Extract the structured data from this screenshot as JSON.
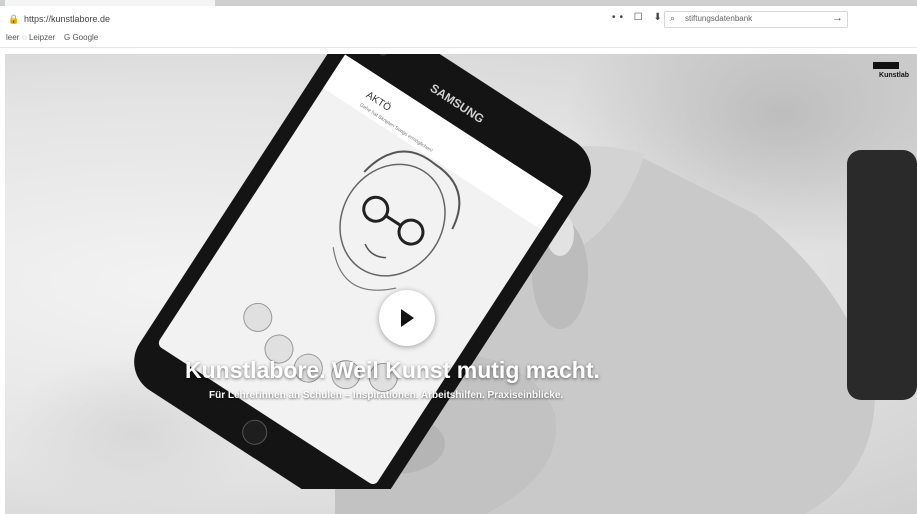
{
  "browser": {
    "url": "https://kunstlabore.de",
    "search_placeholder": "stiftungsdatenbank",
    "url_icons": "••  ☐  ⬇",
    "go_arrow": "→"
  },
  "bookmarks": [
    {
      "label": "leer"
    },
    {
      "label": "Leipzer"
    },
    {
      "label": "Google"
    }
  ],
  "hero": {
    "headline": "Kunstlabore. Weil Kunst mutig macht.",
    "subline": "Für Lehrerinnen an Schulen – Inspirationen. Arbeitshilfen. Praxiseinblicke.",
    "phone_brand": "SAMSUNG",
    "app_title": "AKTÖ",
    "app_subtitle": "Gehe hat Skripten Songs ermöglichen!",
    "logo_text": "Kunstlab"
  }
}
